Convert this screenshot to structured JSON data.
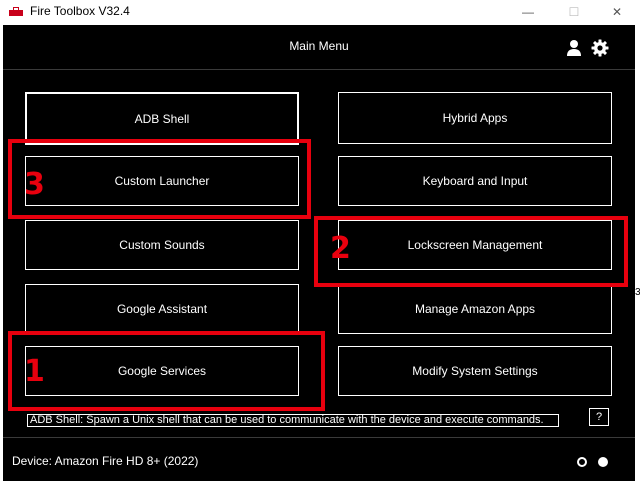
{
  "window": {
    "title": "Fire Toolbox V32.4",
    "minimize_label": "—",
    "maximize_label": "☐",
    "close_label": "✕"
  },
  "header": {
    "title": "Main Menu",
    "icons": [
      "user-icon",
      "gear-icon"
    ]
  },
  "menu": {
    "left": [
      "ADB Shell",
      "Custom Launcher",
      "Custom Sounds",
      "Google Assistant",
      "Google Services"
    ],
    "right": [
      "Hybrid Apps",
      "Keyboard and Input",
      "Lockscreen Management",
      "Manage Amazon Apps",
      "Modify System Settings"
    ]
  },
  "description": "ADB Shell: Spawn a Unix shell that can be used to communicate with the device and execute commands.",
  "help_label": "?",
  "footer": {
    "device": "Device: Amazon Fire HD 8+ (2022)"
  },
  "annotations": {
    "color": "#e8000e",
    "labels": [
      "1",
      "2",
      "3"
    ]
  },
  "side_text": "3"
}
